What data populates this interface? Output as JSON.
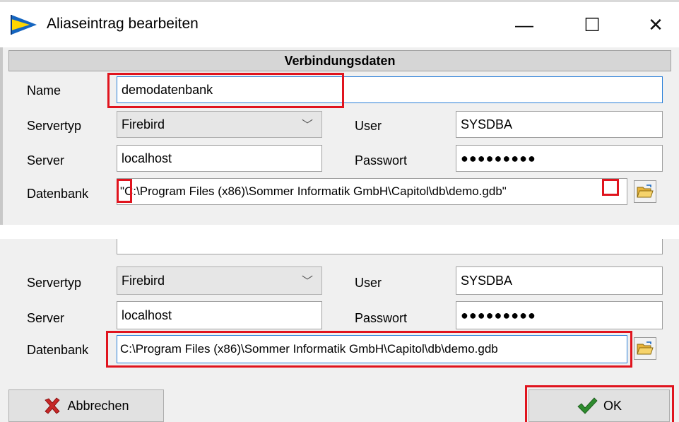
{
  "window": {
    "title": "Aliaseintrag bearbeiten",
    "minimize_glyph": "—",
    "maximize_glyph": "☐",
    "close_glyph": "✕"
  },
  "section": {
    "title": "Verbindungsdaten"
  },
  "labels": {
    "name": "Name",
    "servertyp": "Servertyp",
    "server": "Server",
    "datenbank": "Datenbank",
    "user": "User",
    "passwort": "Passwort"
  },
  "form_top": {
    "name": "demodatenbank",
    "servertyp": "Firebird",
    "server": "localhost",
    "user": "SYSDBA",
    "passwort": "●●●●●●●●●",
    "datenbank": "\"C:\\Program Files (x86)\\Sommer Informatik GmbH\\Capitol\\db\\demo.gdb\""
  },
  "form_bottom": {
    "servertyp": "Firebird",
    "server": "localhost",
    "user": "SYSDBA",
    "passwort": "●●●●●●●●●",
    "datenbank": "C:\\Program Files (x86)\\Sommer Informatik GmbH\\Capitol\\db\\demo.gdb"
  },
  "buttons": {
    "cancel": "Abbrechen",
    "ok": "OK"
  },
  "icons": {
    "app": "flag-arrow-icon",
    "dropdown": "chevron-down-icon",
    "folder": "folder-open-icon",
    "cancel": "red-x-icon",
    "ok": "green-check-icon"
  },
  "colors": {
    "highlight": "#e0141e",
    "dialog_bg": "#f0f0f0",
    "section_bg": "#d6d6d6",
    "focus_border": "#2a7fd8"
  }
}
